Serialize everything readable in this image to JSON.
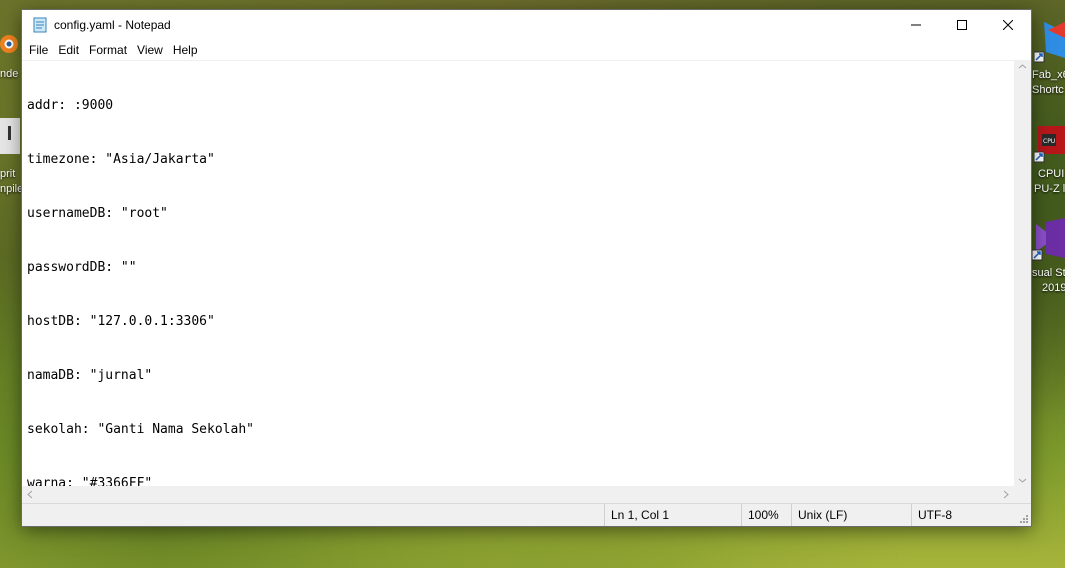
{
  "window": {
    "title": "config.yaml - Notepad"
  },
  "menu": [
    "File",
    "Edit",
    "Format",
    "View",
    "Help"
  ],
  "editor": {
    "lines": [
      "addr: :9000",
      "timezone: \"Asia/Jakarta\"",
      "usernameDB: \"root\"",
      "passwordDB: \"\"",
      "hostDB: \"127.0.0.1:3306\"",
      "namaDB: \"jurnal\"",
      "sekolah: \"Ganti Nama Sekolah\"",
      "warna: \"#3366FF\""
    ]
  },
  "status": {
    "position": "Ln 1, Col 1",
    "zoom": "100%",
    "line_ending": "Unix (LF)",
    "encoding": "UTF-8"
  },
  "desktop": {
    "left_labels": [
      "nde",
      "prit",
      "npile"
    ],
    "right_labels": [
      "Fab_x6",
      "Shortc",
      "CPUI",
      "PU-Z l",
      "sual St",
      "2019"
    ]
  }
}
